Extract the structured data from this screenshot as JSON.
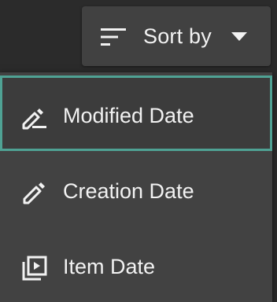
{
  "sort_control": {
    "label": "Sort by",
    "icon": "sort-lines-icon",
    "caret_icon": "caret-down-icon"
  },
  "menu": {
    "selected_index": 0,
    "accent_color": "#4fa294",
    "items": [
      {
        "label": "Modified Date",
        "icon": "edit-note-icon"
      },
      {
        "label": "Creation Date",
        "icon": "pencil-icon"
      },
      {
        "label": "Item Date",
        "icon": "video-library-icon"
      }
    ]
  }
}
